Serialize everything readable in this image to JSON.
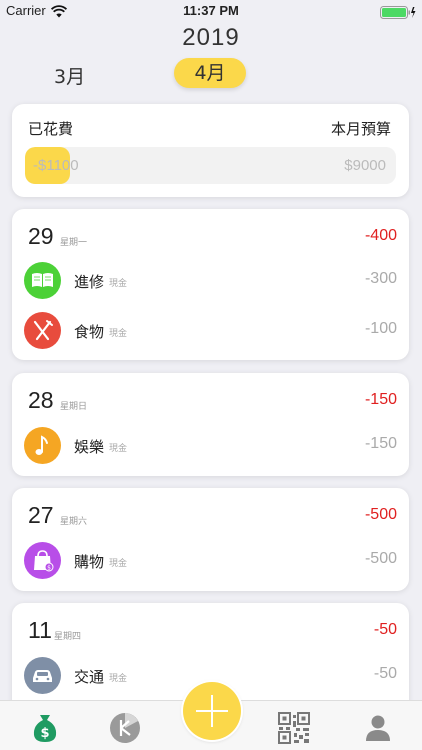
{
  "status_bar": {
    "carrier": "Carrier",
    "time": "11:37 PM"
  },
  "header": {
    "year": "2019",
    "prev_month": "3月",
    "current_month": "4月"
  },
  "budget": {
    "spent_label": "已花費",
    "budget_label": "本月預算",
    "spent_value": "-$1100",
    "budget_value": "$9000",
    "progress_fraction": 0.122
  },
  "days": [
    {
      "day": "29",
      "weekday": "星期一",
      "total": "-400",
      "items": [
        {
          "name": "進修",
          "payment": "現金",
          "amount": "-300",
          "icon": "book-icon",
          "color": "#4cd137"
        },
        {
          "name": "食物",
          "payment": "現金",
          "amount": "-100",
          "icon": "fork-knife-icon",
          "color": "#e84c3d"
        }
      ]
    },
    {
      "day": "28",
      "weekday": "星期日",
      "total": "-150",
      "items": [
        {
          "name": "娛樂",
          "payment": "現金",
          "amount": "-150",
          "icon": "music-note-icon",
          "color": "#f5a623"
        }
      ]
    },
    {
      "day": "27",
      "weekday": "星期六",
      "total": "-500",
      "items": [
        {
          "name": "購物",
          "payment": "現金",
          "amount": "-500",
          "icon": "shopping-bag-icon",
          "color": "#b84ee8"
        }
      ]
    },
    {
      "day": "11",
      "weekday": "星期四",
      "total": "-50",
      "items": [
        {
          "name": "交通",
          "payment": "現金",
          "amount": "-50",
          "icon": "car-icon",
          "color": "#7f8fa6"
        }
      ]
    }
  ],
  "tab_bar": {
    "tabs": [
      "money-bag-icon",
      "pie-chart-icon",
      "add-icon",
      "qr-code-icon",
      "profile-icon"
    ]
  }
}
